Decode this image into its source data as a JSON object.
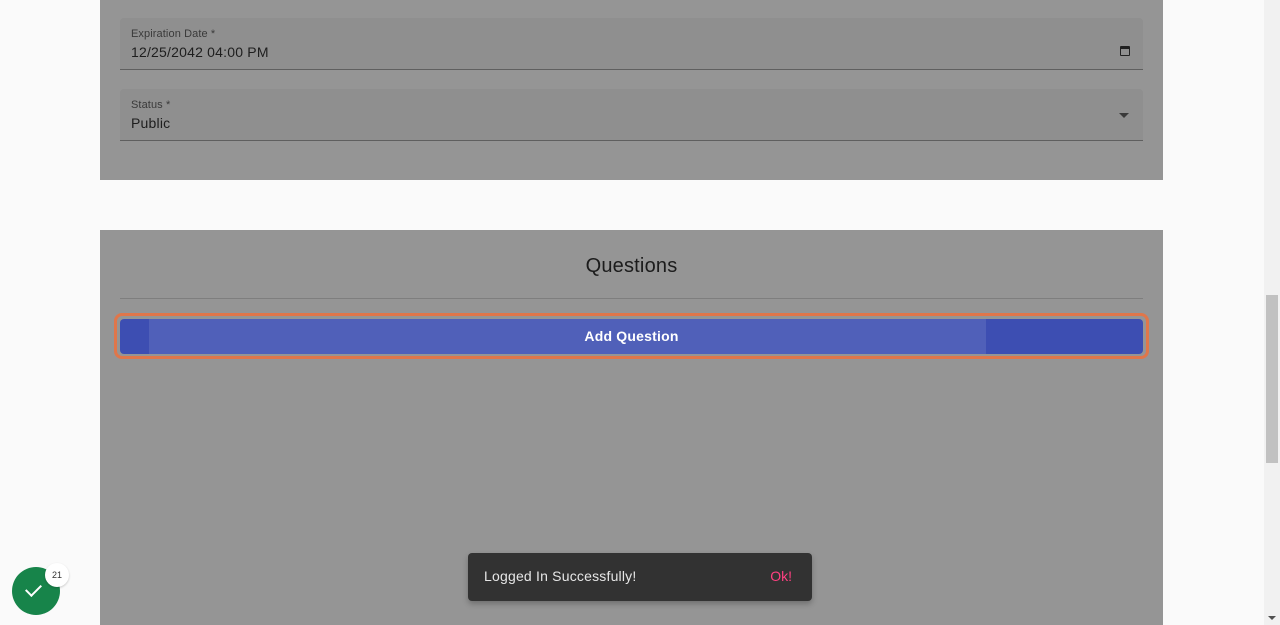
{
  "details": {
    "expiration": {
      "label": "Expiration Date *",
      "value": "12/25/2042 04:00  PM"
    },
    "status": {
      "label": "Status *",
      "value": "Public"
    }
  },
  "questions": {
    "title": "Questions",
    "add_label": "Add Question"
  },
  "snackbar": {
    "message": "Logged In Successfully!",
    "action": "Ok!"
  },
  "status_badge": {
    "count": "21"
  },
  "icons": {
    "calendar": "calendar-icon",
    "dropdown": "chevron-down-icon",
    "check": "check-icon"
  },
  "colors": {
    "primary": "#3d4eb2",
    "focus_ring": "#e0764a",
    "snackbar_action": "#ff4081",
    "success": "#17844a"
  }
}
